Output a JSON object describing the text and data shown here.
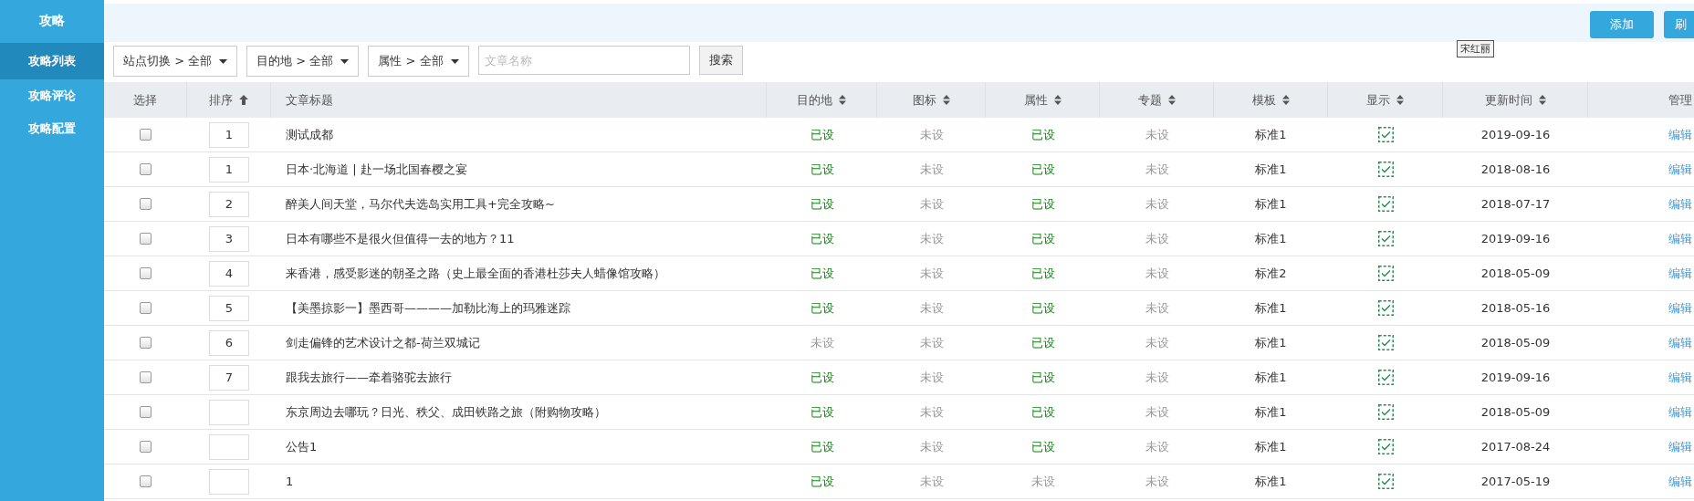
{
  "sidebar": {
    "title": "攻略",
    "items": [
      {
        "label": "攻略列表",
        "selected": true
      },
      {
        "label": "攻略评论",
        "selected": false
      },
      {
        "label": "攻略配置",
        "selected": false
      }
    ]
  },
  "toolbar": {
    "buttons": [
      "添加",
      "刷"
    ],
    "tooltip": "宋红丽"
  },
  "filters": [
    {
      "label": "站点切换 > 全部"
    },
    {
      "label": "目的地 > 全部"
    },
    {
      "label": "属性 > 全部"
    }
  ],
  "search": {
    "placeholder": "文章名称",
    "button": "搜索"
  },
  "table": {
    "columns": [
      {
        "label": "选择",
        "sortable": false,
        "sorted": false
      },
      {
        "label": "排序",
        "sortable": true,
        "sorted": true
      },
      {
        "label": "文章标题",
        "sortable": false,
        "sorted": false
      },
      {
        "label": "目的地",
        "sortable": true,
        "sorted": false
      },
      {
        "label": "图标",
        "sortable": true,
        "sorted": false
      },
      {
        "label": "属性",
        "sortable": true,
        "sorted": false
      },
      {
        "label": "专题",
        "sortable": true,
        "sorted": false
      },
      {
        "label": "模板",
        "sortable": true,
        "sorted": false
      },
      {
        "label": "显示",
        "sortable": true,
        "sorted": false
      },
      {
        "label": "更新时间",
        "sortable": true,
        "sorted": false
      },
      {
        "label": "管理",
        "sortable": false,
        "sorted": false
      }
    ],
    "rows": [
      {
        "checked": false,
        "order": "1",
        "title": "测试成都",
        "flags": [
          {
            "text": "已设",
            "set": true
          },
          {
            "text": "未设",
            "set": false
          },
          {
            "text": "已设",
            "set": true
          },
          {
            "text": "未设",
            "set": false
          }
        ],
        "template": "标准1",
        "shown": true,
        "updated": "2019-09-16",
        "action": "编辑"
      },
      {
        "checked": false,
        "order": "1",
        "title": "日本·北海道 | 赴一场北国春樱之宴",
        "flags": [
          {
            "text": "已设",
            "set": true
          },
          {
            "text": "未设",
            "set": false
          },
          {
            "text": "已设",
            "set": true
          },
          {
            "text": "未设",
            "set": false
          }
        ],
        "template": "标准1",
        "shown": true,
        "updated": "2018-08-16",
        "action": "编辑"
      },
      {
        "checked": false,
        "order": "2",
        "title": "醉美人间天堂，马尔代夫选岛实用工具+完全攻略~",
        "flags": [
          {
            "text": "已设",
            "set": true
          },
          {
            "text": "未设",
            "set": false
          },
          {
            "text": "已设",
            "set": true
          },
          {
            "text": "未设",
            "set": false
          }
        ],
        "template": "标准1",
        "shown": true,
        "updated": "2018-07-17",
        "action": "编辑"
      },
      {
        "checked": false,
        "order": "3",
        "title": "日本有哪些不是很火但值得一去的地方？11",
        "flags": [
          {
            "text": "已设",
            "set": true
          },
          {
            "text": "未设",
            "set": false
          },
          {
            "text": "已设",
            "set": true
          },
          {
            "text": "未设",
            "set": false
          }
        ],
        "template": "标准1",
        "shown": true,
        "updated": "2019-09-16",
        "action": "编辑"
      },
      {
        "checked": false,
        "order": "4",
        "title": "来香港，感受影迷的朝圣之路（史上最全面的香港杜莎夫人蜡像馆攻略）",
        "flags": [
          {
            "text": "已设",
            "set": true
          },
          {
            "text": "未设",
            "set": false
          },
          {
            "text": "已设",
            "set": true
          },
          {
            "text": "未设",
            "set": false
          }
        ],
        "template": "标准2",
        "shown": true,
        "updated": "2018-05-09",
        "action": "编辑"
      },
      {
        "checked": false,
        "order": "5",
        "title": "【美墨掠影一】墨西哥————加勒比海上的玛雅迷踪",
        "flags": [
          {
            "text": "已设",
            "set": true
          },
          {
            "text": "未设",
            "set": false
          },
          {
            "text": "已设",
            "set": true
          },
          {
            "text": "未设",
            "set": false
          }
        ],
        "template": "标准1",
        "shown": true,
        "updated": "2018-05-16",
        "action": "编辑"
      },
      {
        "checked": false,
        "order": "6",
        "title": "剑走偏锋的艺术设计之都-荷兰双城记",
        "flags": [
          {
            "text": "未设",
            "set": false
          },
          {
            "text": "未设",
            "set": false
          },
          {
            "text": "已设",
            "set": true
          },
          {
            "text": "未设",
            "set": false
          }
        ],
        "template": "标准1",
        "shown": true,
        "updated": "2018-05-09",
        "action": "编辑"
      },
      {
        "checked": false,
        "order": "7",
        "title": "跟我去旅行——牵着骆驼去旅行",
        "flags": [
          {
            "text": "已设",
            "set": true
          },
          {
            "text": "未设",
            "set": false
          },
          {
            "text": "已设",
            "set": true
          },
          {
            "text": "未设",
            "set": false
          }
        ],
        "template": "标准1",
        "shown": true,
        "updated": "2019-09-16",
        "action": "编辑"
      },
      {
        "checked": false,
        "title": "东京周边去哪玩？日光、秩父、成田铁路之旅（附购物攻略）",
        "flags": [
          {
            "text": "已设",
            "set": true
          },
          {
            "text": "未设",
            "set": false
          },
          {
            "text": "已设",
            "set": true
          },
          {
            "text": "未设",
            "set": false
          }
        ],
        "template": "标准1",
        "shown": true,
        "updated": "2018-05-09",
        "action": "编辑"
      },
      {
        "checked": false,
        "title": "公告1",
        "flags": [
          {
            "text": "已设",
            "set": true
          },
          {
            "text": "未设",
            "set": false
          },
          {
            "text": "已设",
            "set": true
          },
          {
            "text": "未设",
            "set": false
          }
        ],
        "template": "标准1",
        "shown": true,
        "updated": "2017-08-24",
        "action": "编辑"
      },
      {
        "checked": false,
        "title": "1",
        "flags": [
          {
            "text": "已设",
            "set": true
          },
          {
            "text": "未设",
            "set": false
          },
          {
            "text": "未设",
            "set": false
          },
          {
            "text": "未设",
            "set": false
          }
        ],
        "template": "标准1",
        "shown": true,
        "updated": "2017-05-19",
        "action": "编辑"
      }
    ]
  }
}
